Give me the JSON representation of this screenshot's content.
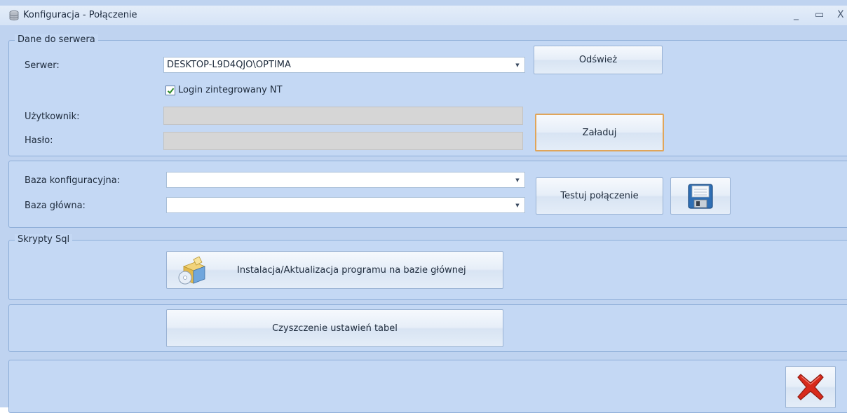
{
  "window": {
    "title": "Konfiguracja - Połączenie",
    "minimize": "_",
    "maximize": "▭",
    "close": "X"
  },
  "server_section": {
    "legend": "Dane do serwera",
    "server_label": "Serwer:",
    "server_value": "DESKTOP-L9D4QJO\\OPTIMA",
    "refresh_button": "Odśwież",
    "nt_login_label": "Login zintegrowany NT",
    "nt_login_checked": true,
    "user_label": "Użytkownik:",
    "user_value": "",
    "password_label": "Hasło:",
    "password_value": "",
    "load_button": "Załaduj"
  },
  "database_section": {
    "config_db_label": "Baza konfiguracyjna:",
    "config_db_value": "",
    "main_db_label": "Baza główna:",
    "main_db_value": "",
    "test_button": "Testuj połączenie",
    "save_icon": "floppy-disk-icon"
  },
  "scripts_section": {
    "legend": "Skrypty Sql",
    "install_button": "Instalacja/Aktualizacja programu na bazie głównej",
    "install_icon": "install-package-icon"
  },
  "cleanup_section": {
    "cleanup_button": "Czyszczenie ustawień tabel"
  },
  "footer": {
    "close_icon": "red-x-close-icon"
  },
  "colors": {
    "window_bg": "#bfd3f0",
    "panel_border": "#8eaed8",
    "focus_border": "#e0a55a",
    "close_red": "#d82a1c"
  }
}
